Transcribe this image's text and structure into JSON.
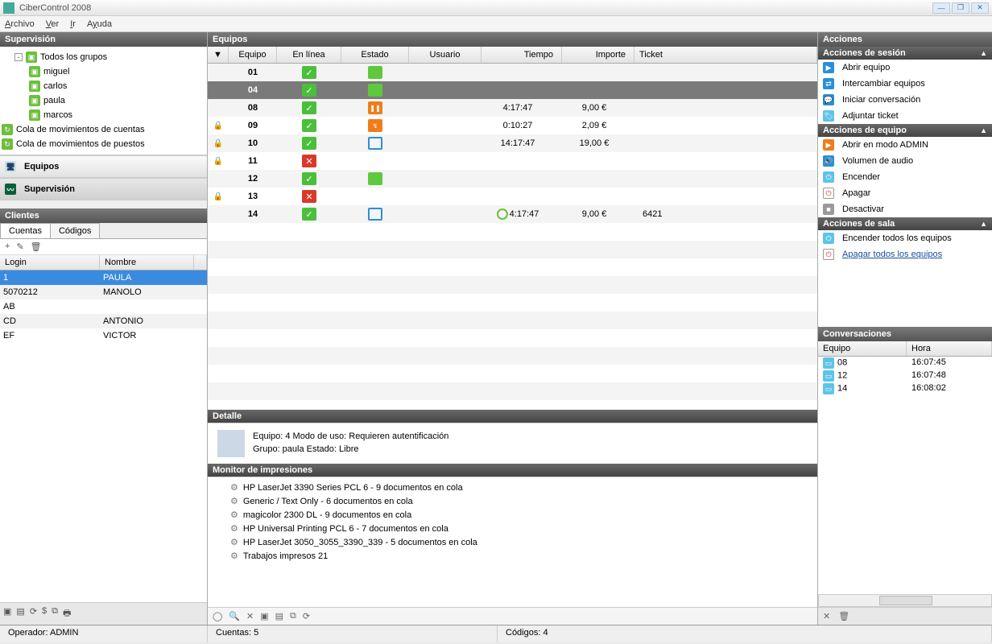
{
  "app_title": "CiberControl 2008",
  "menu": [
    "Archivo",
    "Ver",
    "Ir",
    "Ayuda"
  ],
  "supervision": {
    "title": "Supervisión",
    "root": "Todos los grupos",
    "groups": [
      "miguel",
      "carlos",
      "paula",
      "marcos"
    ],
    "queues": [
      "Cola de movimientos de cuentas",
      "Cola de movimientos de puestos"
    ],
    "nav_equipos": "Equipos",
    "nav_supervision": "Supervisión"
  },
  "clientes": {
    "title": "Clientes",
    "tabs": [
      "Cuentas",
      "Códigos"
    ],
    "cols": [
      "Login",
      "Nombre"
    ],
    "rows": [
      {
        "login": "1",
        "nombre": "PAULA",
        "sel": true
      },
      {
        "login": "5070212",
        "nombre": "MANOLO"
      },
      {
        "login": "AB",
        "nombre": ""
      },
      {
        "login": "CD",
        "nombre": "ANTONIO"
      },
      {
        "login": "EF",
        "nombre": "VICTOR"
      }
    ]
  },
  "equipos": {
    "title": "Equipos",
    "cols": [
      "",
      "Equipo",
      "En línea",
      "Estado",
      "Usuario",
      "Tiempo",
      "Importe",
      "Ticket"
    ],
    "rows": [
      {
        "lock": false,
        "equipo": "01",
        "online": "g",
        "estado": "g"
      },
      {
        "lock": false,
        "equipo": "04",
        "online": "g",
        "estado": "g",
        "sel": true
      },
      {
        "lock": false,
        "equipo": "08",
        "online": "g",
        "estado": "o",
        "tiempo": "4:17:47",
        "importe": "9,00 €"
      },
      {
        "lock": true,
        "equipo": "09",
        "online": "g",
        "estado": "ob",
        "tiempo": "0:10:27",
        "importe": "2,09 €"
      },
      {
        "lock": true,
        "equipo": "10",
        "online": "g",
        "estado": "b",
        "tiempo": "14:17:47",
        "importe": "19,00 €"
      },
      {
        "lock": true,
        "equipo": "11",
        "online": "r"
      },
      {
        "lock": false,
        "equipo": "12",
        "online": "g",
        "estado": "g"
      },
      {
        "lock": true,
        "equipo": "13",
        "online": "r"
      },
      {
        "lock": false,
        "equipo": "14",
        "online": "g",
        "estado": "b",
        "clock": true,
        "tiempo": "4:17:47",
        "importe": "9,00 €",
        "ticket": "6421"
      }
    ]
  },
  "detalle": {
    "title": "Detalle",
    "line1": "Equipo: 4  Modo de uso: Requieren autentificación",
    "line2": "Grupo: paula  Estado:   Libre"
  },
  "monitor": {
    "title": "Monitor de impresiones",
    "items": [
      "HP LaserJet 3390 Series PCL 6 - 9 documentos en cola",
      "Generic / Text Only - 6 documentos en cola",
      "magicolor 2300 DL - 9 documentos en cola",
      "HP Universal Printing PCL 6 - 7 documentos en cola",
      "HP LaserJet 3050_3055_3390_339 - 5 documentos en cola",
      "Trabajos impresos  21"
    ]
  },
  "acciones": {
    "title": "Acciones",
    "sesion": {
      "title": "Acciones de sesión",
      "items": [
        "Abrir equipo",
        "Intercambiar equipos",
        "Iniciar conversación",
        "Adjuntar ticket"
      ]
    },
    "equipo": {
      "title": "Acciones de equipo",
      "items": [
        "Abrir en modo ADMIN",
        "Volumen de audio",
        "Encender",
        "Apagar",
        "Desactivar"
      ]
    },
    "sala": {
      "title": "Acciones de sala",
      "items": [
        "Encender todos los equipos",
        "Apagar todos los equipos"
      ]
    }
  },
  "conversaciones": {
    "title": "Conversaciones",
    "cols": [
      "Equipo",
      "Hora"
    ],
    "rows": [
      {
        "eq": "08",
        "hora": "16:07:45"
      },
      {
        "eq": "12",
        "hora": "16:07:48"
      },
      {
        "eq": "14",
        "hora": "16:08:02"
      }
    ]
  },
  "status": {
    "operador": "Operador: ADMIN",
    "cuentas": "Cuentas: 5",
    "codigos": "Códigos: 4"
  }
}
